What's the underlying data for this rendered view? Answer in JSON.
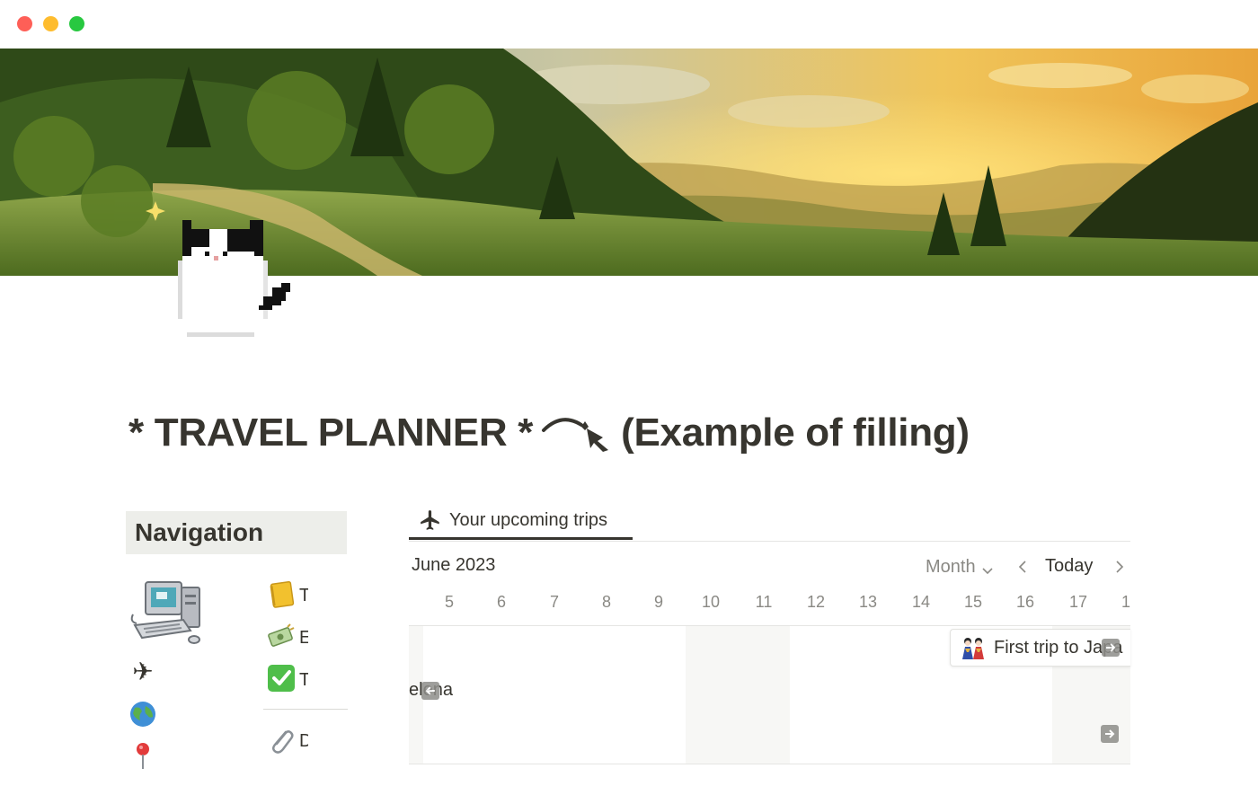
{
  "window": {
    "controls": [
      "close",
      "minimize",
      "zoom"
    ]
  },
  "cover": {
    "description_icon": "landscape-cover-image"
  },
  "page_icon": "pixel-cat-icon",
  "title": {
    "prefix": "* TRAVEL PLANNER *",
    "suffix": "(Example of filling)"
  },
  "navigation": {
    "heading": "Navigation",
    "left_icons": [
      "computer-icon",
      "airplane-icon",
      "globe-icon",
      "pin-icon"
    ],
    "right_items": [
      {
        "icon": "notebook-icon",
        "emoji": "📒",
        "label": "T"
      },
      {
        "icon": "money-icon",
        "emoji": "💸",
        "label": "E"
      },
      {
        "icon": "check-icon",
        "emoji": "✅",
        "label": "T"
      },
      {
        "icon": "paperclip-icon",
        "emoji": "📎",
        "label": "D"
      }
    ]
  },
  "tabs": [
    {
      "label": "Your upcoming trips",
      "icon": "airplane-icon",
      "active": true
    }
  ],
  "calendar": {
    "month_label": "June 2023",
    "view": "Month",
    "today_label": "Today",
    "days": [
      "5",
      "6",
      "7",
      "8",
      "9",
      "10",
      "11",
      "12",
      "13",
      "14",
      "15",
      "16",
      "17",
      "1"
    ],
    "events": [
      {
        "title": "First trip to Japa",
        "icon": "dolls-icon"
      },
      {
        "title": "elena",
        "icon": "arrow-icon"
      }
    ]
  },
  "colors": {
    "text": "#37352f",
    "muted": "#8a8984",
    "nav_bg": "#edeeea",
    "weekend_bg": "#f7f7f5"
  }
}
